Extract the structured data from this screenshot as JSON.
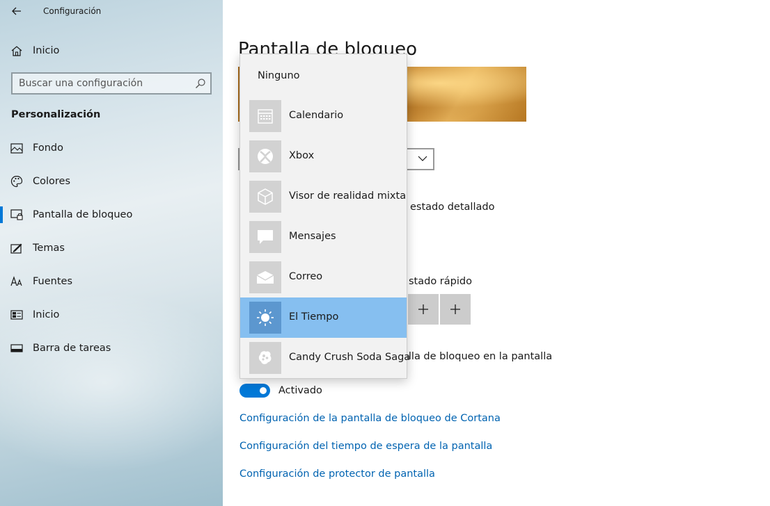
{
  "window": {
    "title": "Configuración"
  },
  "sidebar": {
    "home_label": "Inicio",
    "search_placeholder": "Buscar una configuración",
    "section_header": "Personalización",
    "items": [
      {
        "label": "Fondo",
        "icon": "picture-icon"
      },
      {
        "label": "Colores",
        "icon": "palette-icon"
      },
      {
        "label": "Pantalla de bloqueo",
        "icon": "lock-screen-icon",
        "active": true
      },
      {
        "label": "Temas",
        "icon": "brush-icon"
      },
      {
        "label": "Fuentes",
        "icon": "fonts-icon"
      },
      {
        "label": "Inicio",
        "icon": "start-menu-icon"
      },
      {
        "label": "Barra de tareas",
        "icon": "taskbar-icon"
      }
    ]
  },
  "main": {
    "page_title": "Pantalla de bloqueo",
    "detail_status_label": "estado detallado",
    "quick_status_label": "stado rápido",
    "signin_label": "alla de bloqueo en la pantalla",
    "toggle_label": "Activado",
    "links": [
      "Configuración de la pantalla de bloqueo de Cortana",
      "Configuración del tiempo de espera de la pantalla",
      "Configuración de protector de pantalla"
    ]
  },
  "popup": {
    "none_label": "Ninguno",
    "items": [
      {
        "label": "Calendario",
        "icon": "calendar-icon"
      },
      {
        "label": "Xbox",
        "icon": "xbox-icon"
      },
      {
        "label": "Visor de realidad mixta",
        "icon": "mixed-reality-icon"
      },
      {
        "label": "Mensajes",
        "icon": "message-icon"
      },
      {
        "label": "Correo",
        "icon": "mail-icon"
      },
      {
        "label": "El Tiempo",
        "icon": "weather-sun-icon",
        "selected": true
      },
      {
        "label": "Candy Crush Soda Saga",
        "icon": "candy-crush-icon"
      }
    ]
  },
  "colors": {
    "accent": "#0078d7",
    "link": "#0063b1",
    "selection": "#86bff0"
  }
}
